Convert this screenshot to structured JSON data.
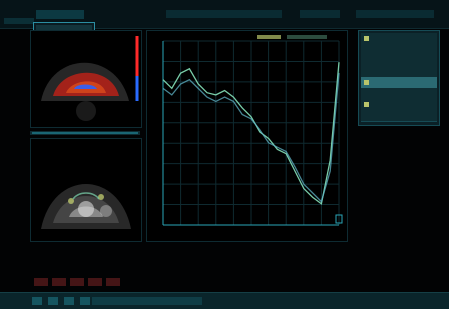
{
  "window": {
    "title": ""
  },
  "topbar": {
    "app_title": "",
    "patient_info": "",
    "status": ""
  },
  "menu": {
    "items": [
      "",
      "",
      ""
    ],
    "selected_index": 2
  },
  "sidebar": {
    "items": [
      {
        "label": "",
        "bullet": true
      },
      {
        "label": "",
        "bullet": false
      },
      {
        "label": "",
        "bullet": false
      },
      {
        "label": "",
        "bullet": false
      },
      {
        "label": "",
        "bullet": true
      },
      {
        "label": "",
        "bullet": false
      },
      {
        "label": "",
        "bullet": true
      },
      {
        "label": "",
        "bullet": false
      }
    ],
    "selected_index": 4
  },
  "colors": {
    "accent": "#1a7f91",
    "curve": "#7ed7b1",
    "cursor": "#2aa6b8",
    "bullet": "#b9c46b"
  },
  "chart_data": {
    "type": "line",
    "title": "",
    "xlabel": "",
    "ylabel": "",
    "grid": true,
    "series": [
      {
        "values": [
          62,
          58,
          65,
          67,
          60,
          56,
          55,
          57,
          54,
          49,
          45,
          38,
          35,
          30,
          28,
          20,
          12,
          8,
          5,
          25,
          70
        ]
      },
      {
        "values": [
          58,
          55,
          60,
          62,
          58,
          54,
          52,
          54,
          52,
          46,
          44,
          39,
          33,
          31,
          29,
          22,
          14,
          10,
          6,
          20,
          65
        ]
      }
    ]
  }
}
